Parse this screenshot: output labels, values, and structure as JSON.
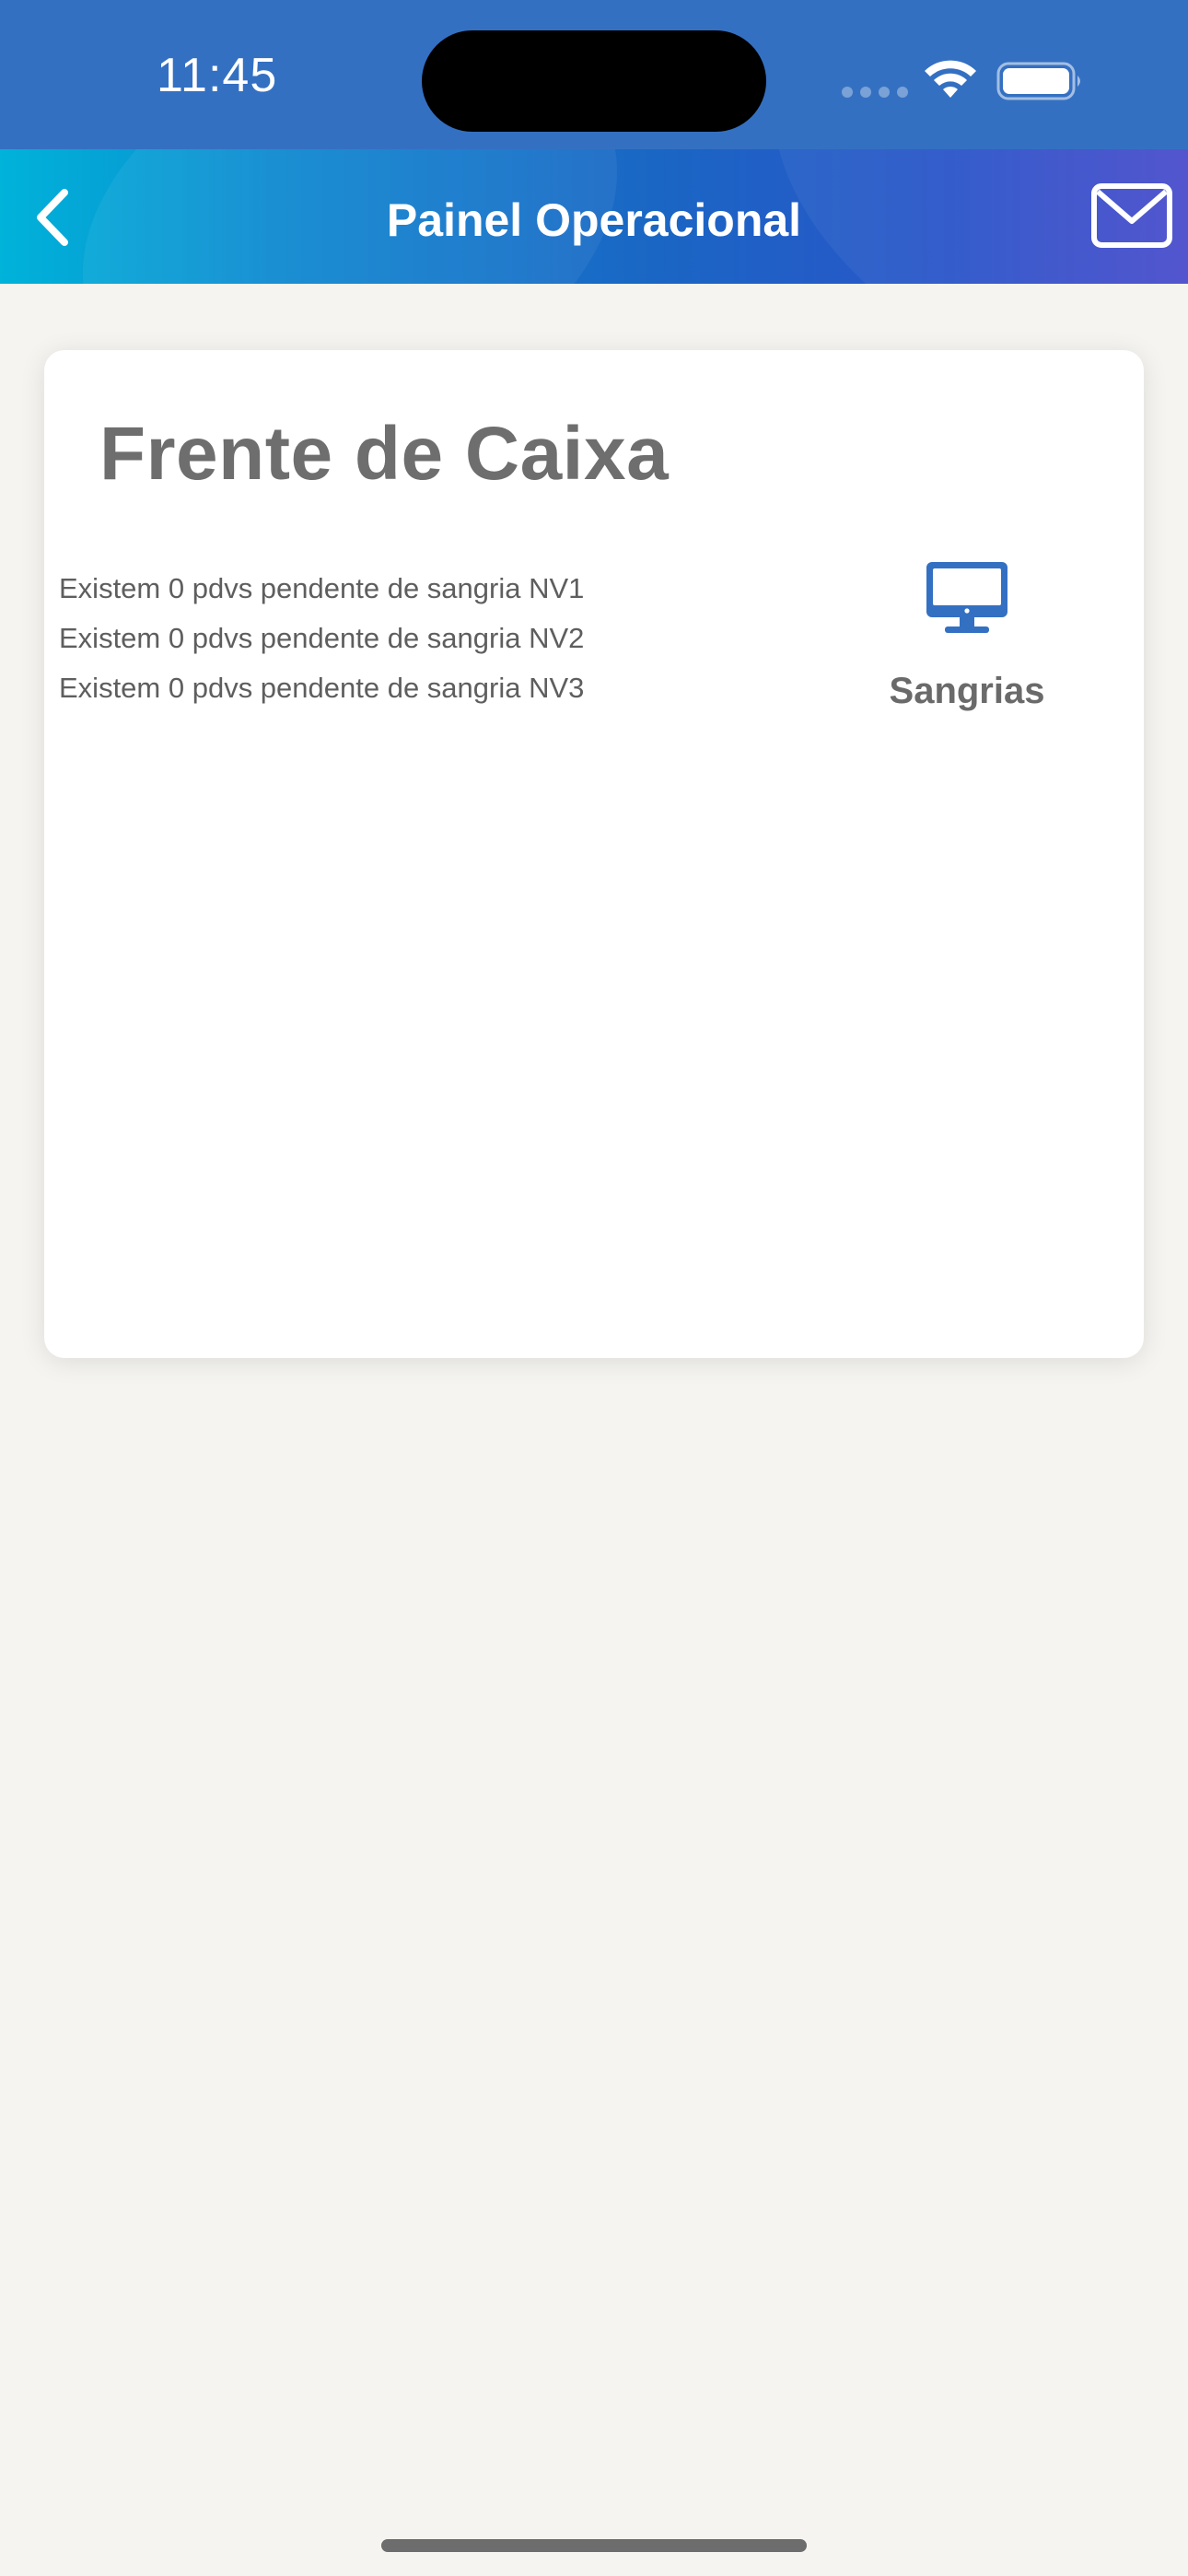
{
  "status_bar": {
    "time": "11:45",
    "icons": [
      "cellular-signal-icon",
      "wifi-icon",
      "battery-icon"
    ]
  },
  "nav_bar": {
    "title": "Painel Operacional",
    "back_icon": "chevron-left-icon",
    "mail_icon": "mail-icon"
  },
  "card": {
    "title": "Frente de Caixa",
    "pending_items": [
      "Existem 0 pdvs pendente de sangria NV1",
      "Existem 0 pdvs pendente de sangria NV2",
      "Existem 0 pdvs pendente de sangria NV3"
    ],
    "action": {
      "label": "Sangrias",
      "icon": "desktop-monitor-icon"
    }
  },
  "colors": {
    "status_bar_bg": "#3470c2",
    "nav_gradient_start": "#00b3d9",
    "nav_gradient_end": "#4a4ccc",
    "accent_icon": "#3470c2",
    "page_bg": "#f5f4f0",
    "card_title": "#6e6e6e"
  }
}
